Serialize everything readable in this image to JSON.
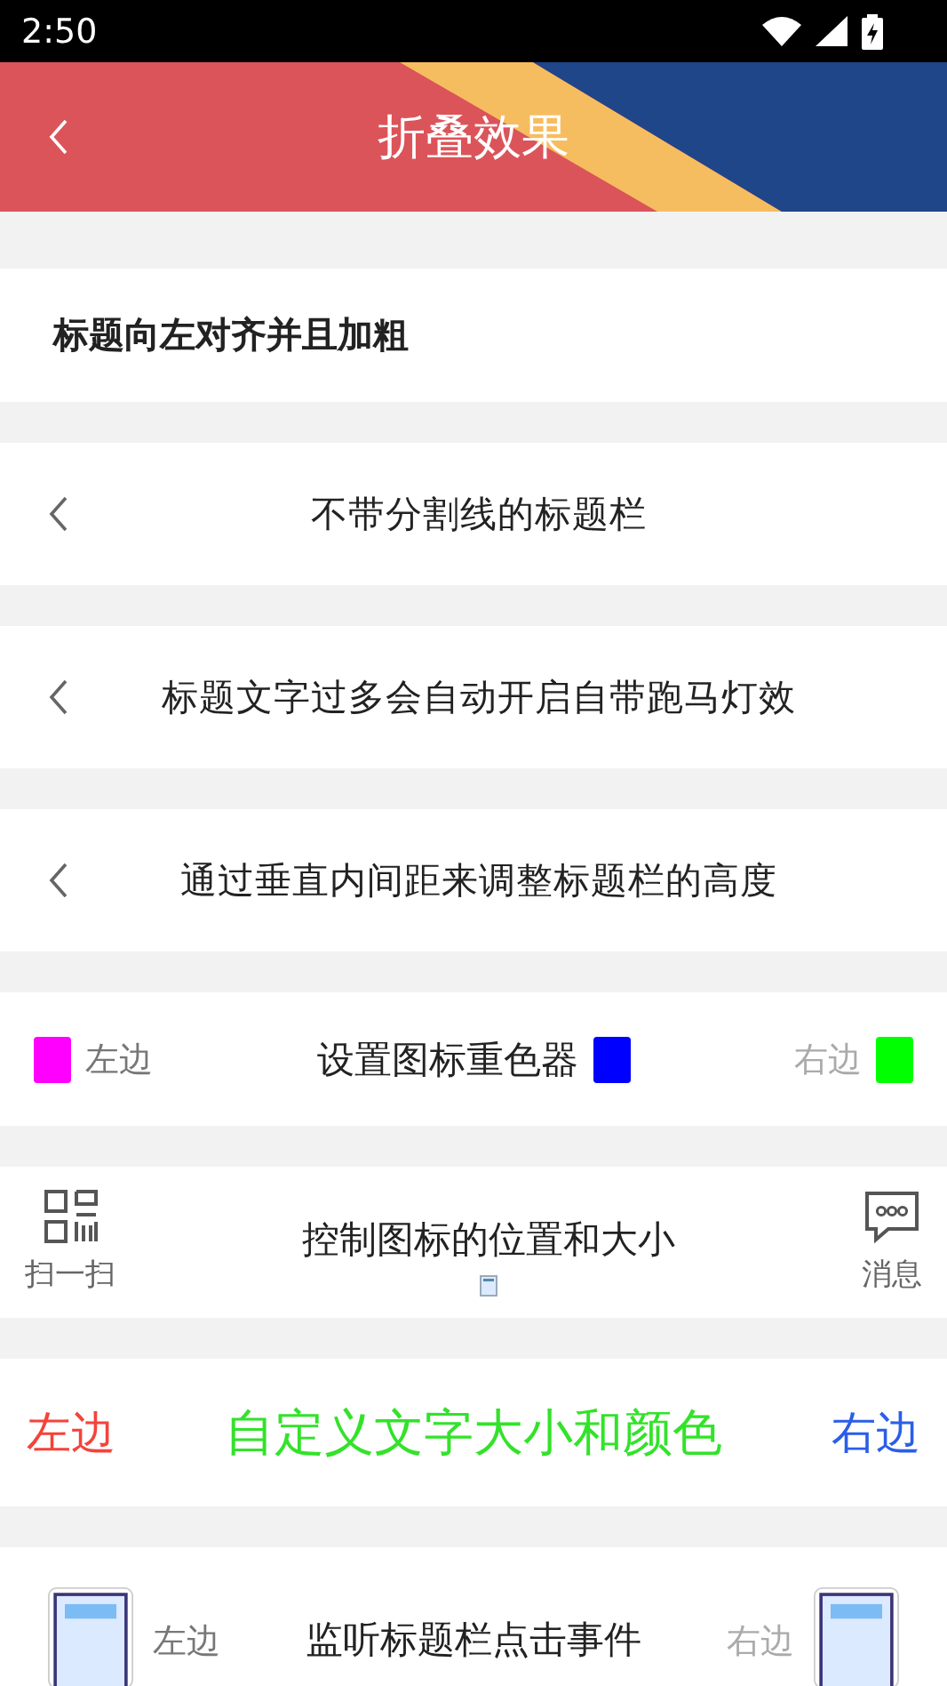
{
  "status_bar": {
    "time": "2:50"
  },
  "title_bar": {
    "title": "折叠效果"
  },
  "rows": [
    {
      "kind": "bold_left",
      "title": "标题向左对齐并且加粗"
    },
    {
      "kind": "back_center",
      "title": "不带分割线的标题栏"
    },
    {
      "kind": "back_center",
      "title": "标题文字过多会自动开启自带跑马灯效"
    },
    {
      "kind": "back_center",
      "title": "通过垂直内间距来调整标题栏的高度"
    },
    {
      "kind": "tinted_icons",
      "left": {
        "label": "左边",
        "color": "#ff00ff"
      },
      "center": {
        "label": "设置图标重色器",
        "color": "#0000ff"
      },
      "right": {
        "label": "右边",
        "color": "#00ff00"
      }
    },
    {
      "kind": "icon_labels",
      "left": {
        "label": "扫一扫"
      },
      "title": "控制图标的位置和大小",
      "right": {
        "label": "消息"
      }
    },
    {
      "kind": "colored_texts",
      "left": {
        "label": "左边",
        "color": "#f4433b"
      },
      "center": {
        "label": "自定义文字大小和颜色",
        "color": "#33e22a"
      },
      "right": {
        "label": "右边",
        "color": "#2b5ee8"
      }
    },
    {
      "kind": "image_buttons",
      "left": {
        "label": "左边"
      },
      "title": "监听标题栏点击事件",
      "right": {
        "label": "右边"
      }
    }
  ]
}
